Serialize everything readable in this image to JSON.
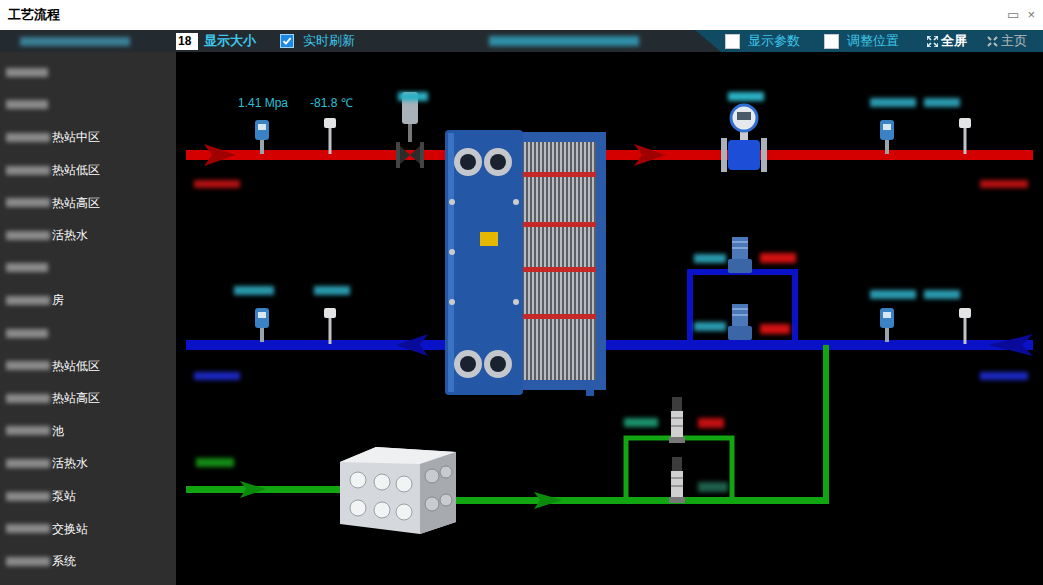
{
  "window": {
    "title": "工艺流程",
    "controls": [
      "▭",
      "×"
    ]
  },
  "toolbar": {
    "size_value": "18",
    "size_label": "显示大小",
    "realtime": {
      "label": "实时刷新",
      "checked": true
    },
    "show_params": {
      "label": "显示参数",
      "checked": false
    },
    "adjust_position": {
      "label": "调整位置",
      "checked": false
    },
    "fullscreen": "全屏",
    "home": "主页"
  },
  "sidebar": {
    "items": [
      {
        "label": "",
        "selected": false
      },
      {
        "label": "",
        "selected": false
      },
      {
        "label": "热站中区",
        "selected": false
      },
      {
        "label": "热站低区",
        "selected": false
      },
      {
        "label": "热站高区",
        "selected": false
      },
      {
        "label": "活热水",
        "selected": false
      },
      {
        "label": "",
        "selected": false
      },
      {
        "label": "房",
        "selected": false
      },
      {
        "label": "",
        "selected": false
      },
      {
        "label": "热站低区",
        "selected": false
      },
      {
        "label": "热站高区",
        "selected": false
      },
      {
        "label": "池",
        "selected": false
      },
      {
        "label": "活热水",
        "selected": false
      },
      {
        "label": "泵站",
        "selected": false
      },
      {
        "label": "交换站",
        "selected": false
      },
      {
        "label": "系统",
        "selected": false
      }
    ]
  },
  "diagram": {
    "readings": [
      "1.41 Mpa",
      "-81.8 ℃"
    ]
  }
}
